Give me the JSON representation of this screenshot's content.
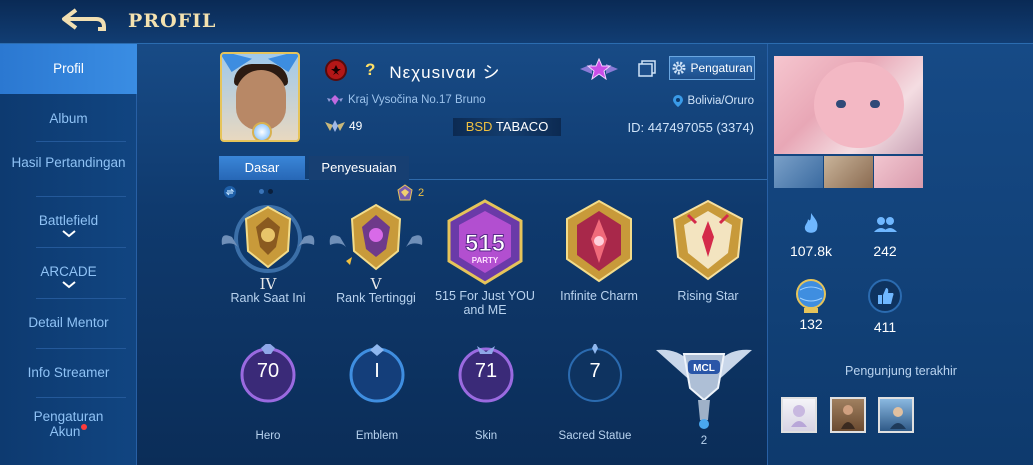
{
  "header": {
    "title": "PROFIL"
  },
  "sidebar": {
    "items": [
      {
        "label": "Profil",
        "active": true
      },
      {
        "label": "Album"
      },
      {
        "label": "Hasil Pertandingan"
      },
      {
        "label": "Battlefield",
        "chevron": true
      },
      {
        "label": "ARCADE",
        "chevron": true
      },
      {
        "label": "Detail Mentor"
      },
      {
        "label": "Info Streamer"
      },
      {
        "label": "Pengaturan Akun",
        "notification": true
      }
    ]
  },
  "player": {
    "name": "Nεχusιvαи シ",
    "question_mark": "?",
    "location": "Kraj Vysočina No.17 Bruno",
    "region": "Bolivia/Oruro",
    "level": "49",
    "squad_tag": "BSD",
    "squad_name": "TABACO",
    "id_text": "ID: 447497055 (3374)",
    "settings_label": "Pengaturan"
  },
  "tabs": {
    "basic": "Dasar",
    "custom": "Penyesuaian"
  },
  "small_badge_count": "2",
  "medals": [
    {
      "roman": "IV",
      "label": "Rank Saat Ini"
    },
    {
      "roman": "V",
      "label": "Rank Tertinggi"
    },
    {
      "label": "515 For Just YOU and ME",
      "badge_text": "515",
      "badge_sub": "PARTY"
    },
    {
      "label": "Infinite Charm"
    },
    {
      "label": "Rising Star"
    }
  ],
  "stats": [
    {
      "value": "70",
      "label": "Hero"
    },
    {
      "value": "I",
      "label": "Emblem"
    },
    {
      "value": "71",
      "label": "Skin"
    },
    {
      "value": "7",
      "label": "Sacred Statue"
    },
    {
      "value": "2",
      "label": "",
      "mcl_text": "MCL"
    }
  ],
  "right": {
    "popularity": "107.8k",
    "friends": "242",
    "achievement": "132",
    "likes": "411",
    "recent_visitors_label": "Pengunjung terakhir"
  },
  "colors": {
    "accent": "#2b78d1",
    "gold": "#e6c45a",
    "text_light": "#b9d3ef"
  }
}
